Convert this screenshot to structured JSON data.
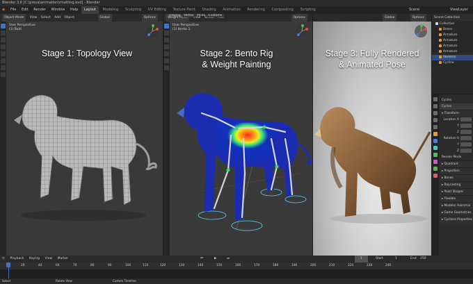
{
  "window": {
    "title": "Blender 3.6 [C:\\prova\\animation\\rmatting.exd] - Blender"
  },
  "menu": {
    "items": [
      "File",
      "Edit",
      "Render",
      "Window",
      "Help"
    ],
    "workspaces": [
      "Layout",
      "Modeling",
      "Sculpting",
      "UV Editing",
      "Texture Paint",
      "Shading",
      "Animation",
      "Rendering",
      "Compositing",
      "Scripting"
    ],
    "active_workspace": "Layout",
    "scene": "Scene",
    "view_layer": "ViewLayer"
  },
  "viewport1": {
    "mode": "Object Mode",
    "menus": [
      "View",
      "Select",
      "Add",
      "Object"
    ],
    "transform": "Global",
    "options": "Options",
    "info_line1": "User Perspective",
    "info_line2": "(1) Bald",
    "stage_title": "Stage 1: Topology View"
  },
  "viewport2": {
    "mode": "Weight Paint",
    "menus": [
      "View",
      "Select",
      "Add"
    ],
    "display_label": "Display",
    "display_value": "Vertex",
    "mode_label": "Mode",
    "mode_value": "Customs",
    "options": "Options",
    "info_line1": "User Perspective",
    "info_line2": "(1) Bento 1",
    "stage_title_line1": "Stage 2: Bento Rig",
    "stage_title_line2": "& Weight Painting"
  },
  "viewport3": {
    "transform": "Global",
    "options": "Options",
    "stage_title_line1": "Stage 3: Fully Rendered",
    "stage_title_line2": "& Animated Pose"
  },
  "outliner": {
    "title": "Scene Collection",
    "items": [
      "Collection",
      "Bones",
      "Armature",
      "Armature",
      "Armature",
      "Armature",
      "Skeleton",
      "Cycline"
    ]
  },
  "properties": {
    "object_name": "Cycles",
    "sub_name": "Cycles",
    "sections": [
      "Transform",
      "Location X",
      "Y",
      "Z",
      "Rotation X",
      "Y",
      "Z",
      "Render Mode",
      "Quadrant",
      "Proportion",
      "Bones",
      "Raycasting",
      "Point Shapes",
      "Flexible",
      "Modeler Hairsmin",
      "Game Geometries",
      "Cyclosis Properties"
    ]
  },
  "timeline": {
    "menus": [
      "Playback",
      "Keying",
      "View",
      "Marker"
    ],
    "current_frame": "1",
    "start_label": "Start",
    "start_value": "1",
    "end_label": "End",
    "end_value": "250",
    "ruler": [
      "1",
      "20",
      "40",
      "60",
      "70",
      "80",
      "90",
      "100",
      "110",
      "120",
      "130",
      "140",
      "150",
      "160",
      "170",
      "180",
      "190",
      "200",
      "210",
      "220",
      "230",
      "240"
    ]
  },
  "status": {
    "left": "Select",
    "mid": "Rotate View",
    "right": "Custom Timeline"
  },
  "colors": {
    "accent": "#4772b3",
    "orange": "#e59a3c"
  }
}
